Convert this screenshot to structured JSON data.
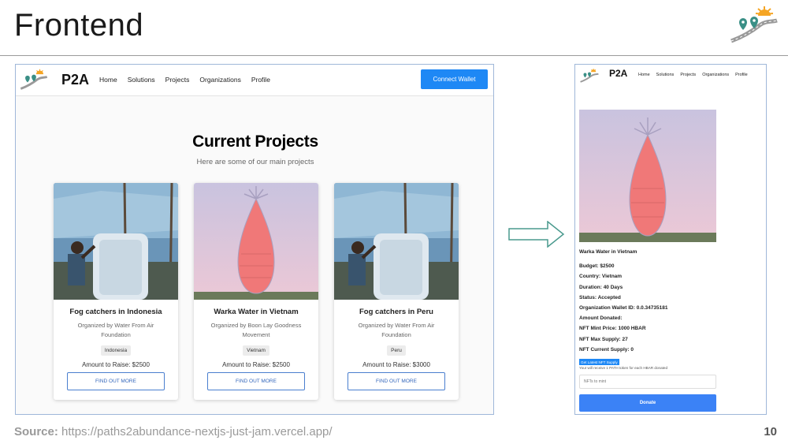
{
  "slide": {
    "title": "Frontend",
    "source_label": "Source:",
    "source_url": "https://paths2abundance-nextjs-just-jam.vercel.app/",
    "page_number": "10"
  },
  "desktop": {
    "brand": "P2A",
    "nav": [
      "Home",
      "Solutions",
      "Projects",
      "Organizations",
      "Profile"
    ],
    "connect_button": "Connect Wallet",
    "heading": "Current Projects",
    "subheading": "Here are some of our main projects",
    "cards": [
      {
        "title": "Fog catchers in Indonesia",
        "organizer": "Organized by Water From Air Foundation",
        "country": "Indonesia",
        "amount": "Amount to Raise: $2500",
        "button": "FIND OUT MORE",
        "image": "fog-catcher-photo"
      },
      {
        "title": "Warka Water in Vietnam",
        "organizer": "Organized by Boon Lay Goodness Movement",
        "country": "Vietnam",
        "amount": "Amount to Raise: $2500",
        "button": "FIND OUT MORE",
        "image": "warka-tower-photo"
      },
      {
        "title": "Fog catchers in Peru",
        "organizer": "Organized by Water From Air Foundation",
        "country": "Peru",
        "amount": "Amount to Raise: $3000",
        "button": "FIND OUT MORE",
        "image": "fog-catcher-photo"
      }
    ]
  },
  "mobile": {
    "brand": "P2A",
    "nav": [
      "Home",
      "Solutions",
      "Projects",
      "Organizations",
      "Profile"
    ],
    "project_name": "Warka Water in Vietnam",
    "details": [
      "Budget: $2500",
      "Country: Vietnam",
      "Duration: 40 Days",
      "Status: Accepted",
      "Organization Wallet ID: 0.0.34735181",
      "Amount Donated:",
      "NFT Mint Price: 1000 HBAR",
      "NFT Max Supply: 27",
      "NFT Current Supply: 0"
    ],
    "supply_button": "Get Latest NFT Supply",
    "receive_note": "Your will receive 1 PATH token for each HBAR donated",
    "mint_placeholder": "NFTs to mint",
    "donate_button": "Donate"
  },
  "colors": {
    "accent_blue": "#1e88f5",
    "frame_border": "#9fb7d9",
    "arrow_stroke": "#4a9a8e",
    "logo_orange": "#f5a524",
    "logo_teal": "#3a8f86"
  }
}
